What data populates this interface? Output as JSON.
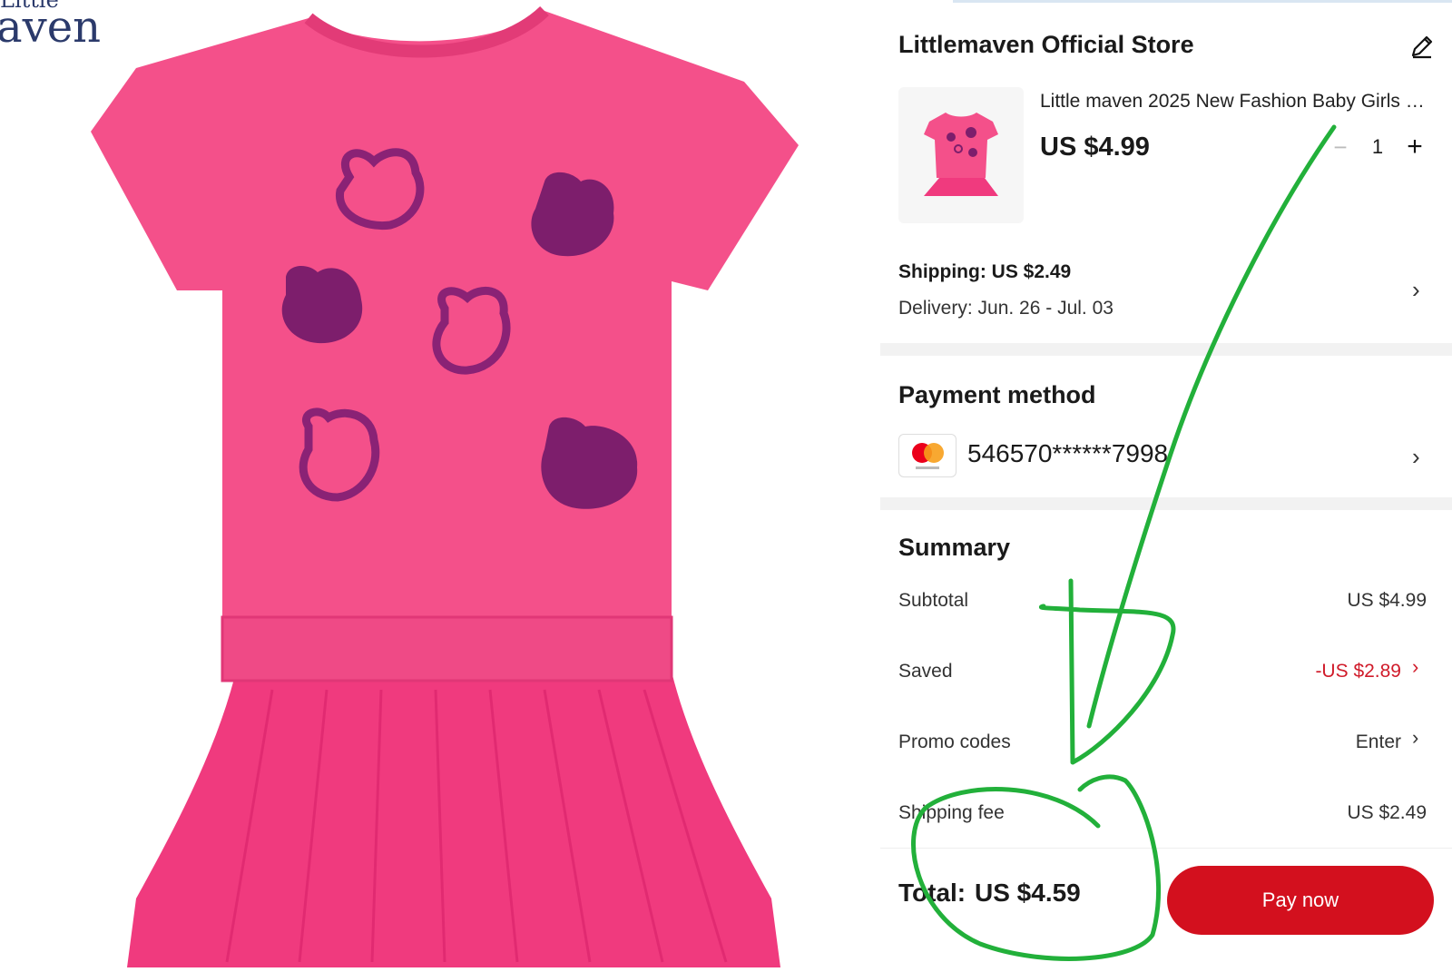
{
  "brand": {
    "line1": "Little",
    "line2": "aven"
  },
  "store": {
    "title": "Littlemaven Official Store",
    "edit_icon": "pencil-icon"
  },
  "product": {
    "name": "Little maven 2025 New Fashion Baby Girls …",
    "price": "US $4.99",
    "quantity": "1",
    "minus_icon": "minus-icon",
    "plus_icon": "plus-icon"
  },
  "shipping": {
    "label": "Shipping:",
    "value": "US $2.49",
    "delivery": "Delivery: Jun. 26 - Jul. 03"
  },
  "payment": {
    "title": "Payment method",
    "card_number": "546570******7998",
    "card_brand": "mastercard"
  },
  "summary": {
    "title": "Summary",
    "rows": [
      {
        "label": "Subtotal",
        "value": "US $4.99"
      },
      {
        "label": "Saved",
        "value": "-US $2.89"
      },
      {
        "label": "Promo codes",
        "value": "Enter"
      },
      {
        "label": "Shipping fee",
        "value": "US $2.49"
      }
    ]
  },
  "footer": {
    "total_label": "Total:",
    "total_value": "US $4.59",
    "pay_button": "Pay now"
  },
  "colors": {
    "accent": "#d3101e",
    "saved_red": "#d01b2a",
    "shirt_pink": "#f4508a",
    "skirt_pink": "#f03a7e",
    "sequin_purple": "#7d1e6c",
    "annotation_green": "#22b03a"
  }
}
